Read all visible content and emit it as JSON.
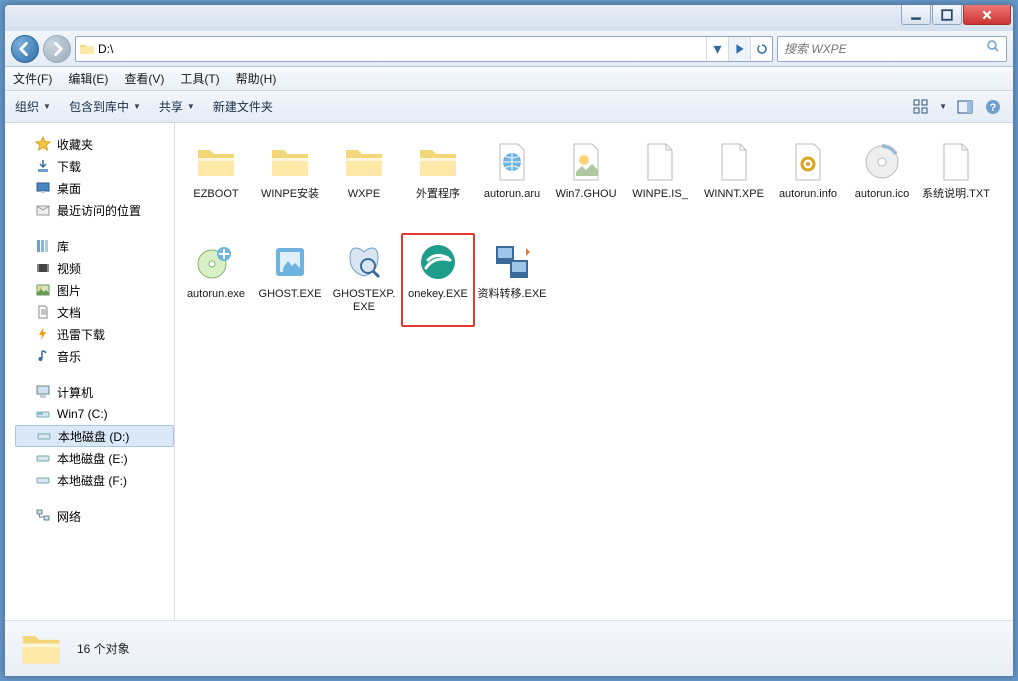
{
  "window": {
    "min_name": "minimize-button",
    "max_name": "maximize-button",
    "close_name": "close-button"
  },
  "nav": {
    "address": "D:\\",
    "search_placeholder": "搜索 WXPE"
  },
  "menubar": [
    "文件(F)",
    "编辑(E)",
    "查看(V)",
    "工具(T)",
    "帮助(H)"
  ],
  "toolbar": {
    "organize": "组织",
    "include": "包含到库中",
    "share": "共享",
    "newfolder": "新建文件夹"
  },
  "sidebar": {
    "favorites": {
      "label": "收藏夹",
      "items": [
        "下载",
        "桌面",
        "最近访问的位置"
      ]
    },
    "libraries": {
      "label": "库",
      "items": [
        "视频",
        "图片",
        "文档",
        "迅雷下载",
        "音乐"
      ]
    },
    "computer": {
      "label": "计算机",
      "items": [
        "Win7 (C:)",
        "本地磁盘 (D:)",
        "本地磁盘 (E:)",
        "本地磁盘 (F:)"
      ],
      "selected_index": 1
    },
    "network": {
      "label": "网络"
    }
  },
  "files": [
    {
      "name": "EZBOOT",
      "label": "EZBOOT",
      "icon": "folder"
    },
    {
      "name": "WINPE",
      "label": "WINPE安装",
      "icon": "folder"
    },
    {
      "name": "WXPE",
      "label": "WXPE",
      "icon": "folder"
    },
    {
      "name": "external",
      "label": "外置程序",
      "icon": "folder"
    },
    {
      "name": "autorunaru",
      "label": "autorun.aru",
      "icon": "file-globe"
    },
    {
      "name": "win7ghou",
      "label": "Win7.GHOU",
      "icon": "file-generic"
    },
    {
      "name": "winpeis",
      "label": "WINPE.IS_",
      "icon": "file-blank"
    },
    {
      "name": "winntxpe",
      "label": "WINNT.XPE",
      "icon": "file-blank"
    },
    {
      "name": "autoruninfo",
      "label": "autorun.info",
      "icon": "file-gear"
    },
    {
      "name": "autorunico",
      "label": "autorun.ico",
      "icon": "disc"
    },
    {
      "name": "desc",
      "label": "系统说明.TXT",
      "icon": "file-blank"
    },
    {
      "name": "autorunexe",
      "label": "autorun.exe",
      "icon": "exe-disc"
    },
    {
      "name": "ghostexe",
      "label": "GHOST.EXE",
      "icon": "ghost"
    },
    {
      "name": "ghostexpexe",
      "label": "GHOSTEXP.EXE",
      "icon": "ghostexp"
    },
    {
      "name": "onekeyexe",
      "label": "onekey.EXE",
      "icon": "onekey",
      "highlight": true
    },
    {
      "name": "transfer",
      "label": "资料转移.EXE",
      "icon": "transfer"
    }
  ],
  "status": {
    "count_text": "16 个对象"
  }
}
